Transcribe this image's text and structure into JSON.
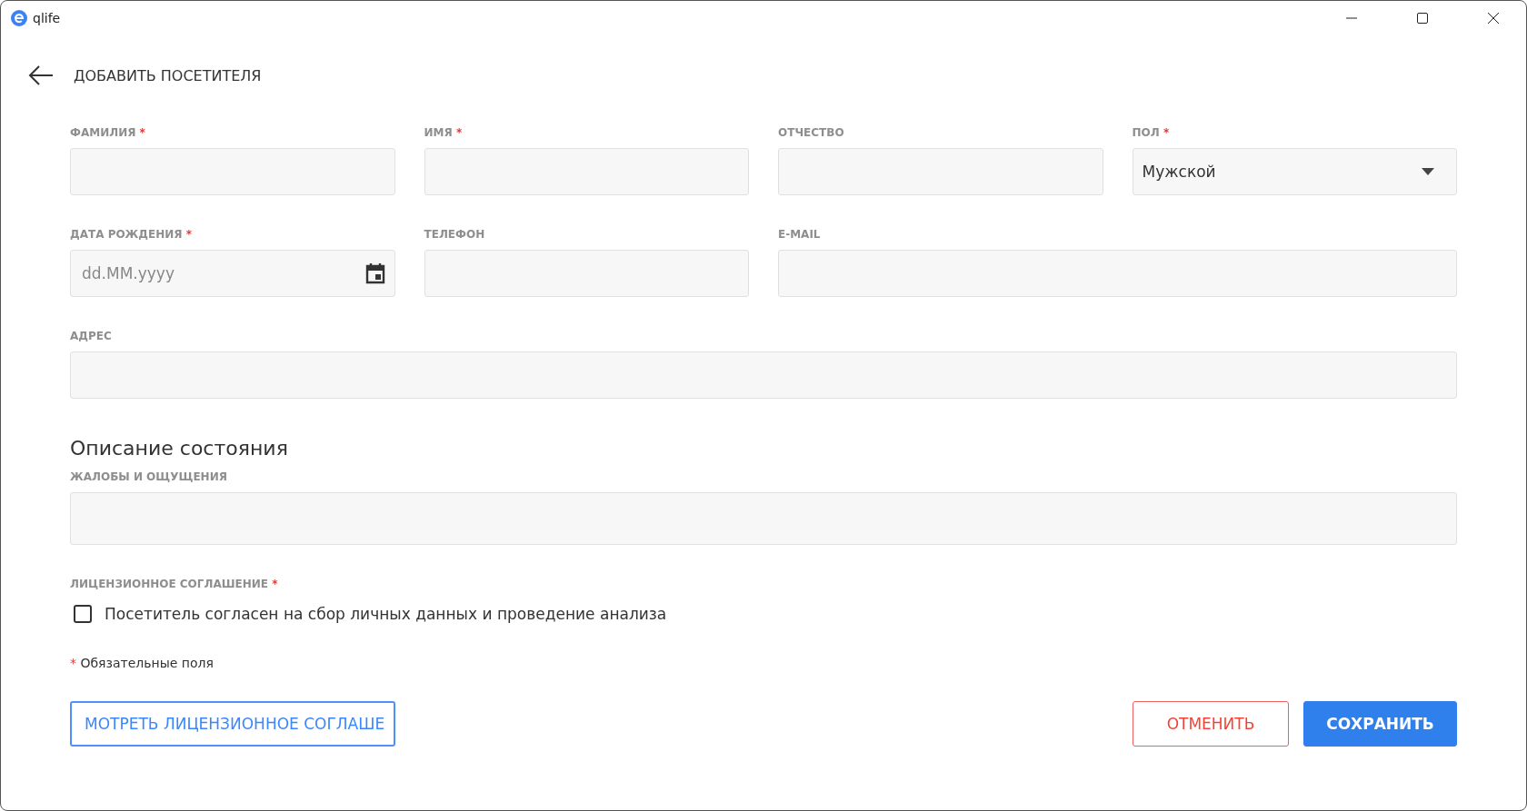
{
  "window": {
    "title": "qlife"
  },
  "header": {
    "title": "ДОБАВИТЬ ПОСЕТИТЕЛЯ"
  },
  "field_rows": [
    [
      {
        "kind": "text",
        "label": "ФАМИЛИЯ",
        "required_mark": "*"
      },
      {
        "kind": "text",
        "label": "ИМЯ",
        "required_mark": "*"
      },
      {
        "kind": "text",
        "label": "ОТЧЕСТВО"
      },
      {
        "kind": "select",
        "label": "ПОЛ",
        "required_mark": "*",
        "value": "Мужской"
      }
    ],
    [
      {
        "kind": "date",
        "label": "ДАТА РОЖДЕНИЯ",
        "required_mark": "*",
        "placeholder": "dd.MM.yyyy"
      },
      {
        "kind": "text",
        "label": "ТЕЛЕФОН"
      },
      {
        "kind": "text",
        "label": "E-MAIL"
      }
    ],
    [
      {
        "kind": "text",
        "label": "АДРЕС"
      }
    ]
  ],
  "condition_section": {
    "title": "Описание состояния",
    "fields": [
      {
        "kind": "text",
        "label": "ЖАЛОБЫ И ОЩУЩЕНИЯ"
      }
    ]
  },
  "license": {
    "label": "ЛИЦЕНЗИОННОЕ СОГЛАШЕНИЕ",
    "required_mark": "*",
    "checkbox": {
      "label": "Посетитель согласен на сбор личных данных и проведение анализа",
      "checked": false
    }
  },
  "required_note": {
    "mark": "*",
    "text": "Обязательные поля"
  },
  "buttons": [
    {
      "kind": "outline-primary",
      "label": "МОТРЕТЬ ЛИЦЕНЗИОННОЕ СОГЛАШЕ"
    },
    {
      "kind": "outline-danger",
      "label": "ОТМЕНИТЬ"
    },
    {
      "kind": "primary",
      "label": "СОХРАНИТЬ"
    }
  ]
}
